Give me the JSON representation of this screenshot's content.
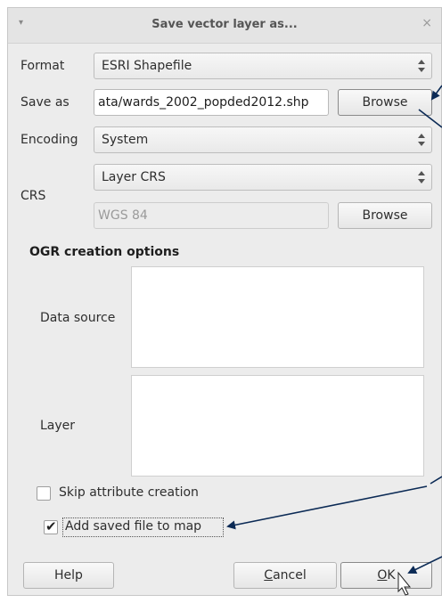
{
  "window": {
    "title": "Save vector layer as...",
    "menu_icon": "menu-arrow-icon",
    "close_icon": "close-icon",
    "menu_glyph": "▾",
    "close_glyph": "×"
  },
  "form": {
    "format_label": "Format",
    "format_value": "ESRI Shapefile",
    "save_as_label": "Save as",
    "save_as_value": "ata/wards_2002_popded2012.shp",
    "browse_label": "Browse",
    "encoding_label": "Encoding",
    "encoding_value": "System",
    "crs_label": "CRS",
    "crs_mode_value": "Layer CRS",
    "crs_value": "WGS 84",
    "crs_browse_label": "Browse"
  },
  "ogr": {
    "title": "OGR creation options",
    "data_source_label": "Data source",
    "layer_label": "Layer"
  },
  "options": {
    "skip_attr_label": "Skip attribute creation",
    "skip_attr_checked": false,
    "add_to_map_label": "Add saved file to map",
    "add_to_map_checked": true,
    "check_glyph": "✔"
  },
  "buttons": {
    "help": "Help",
    "cancel_mnemonic": "C",
    "cancel_rest": "ancel",
    "ok_mnemonic": "O",
    "ok_rest": "K"
  },
  "colors": {
    "annotation_arrow": "#0b2a55",
    "dialog_bg": "#ececec"
  }
}
